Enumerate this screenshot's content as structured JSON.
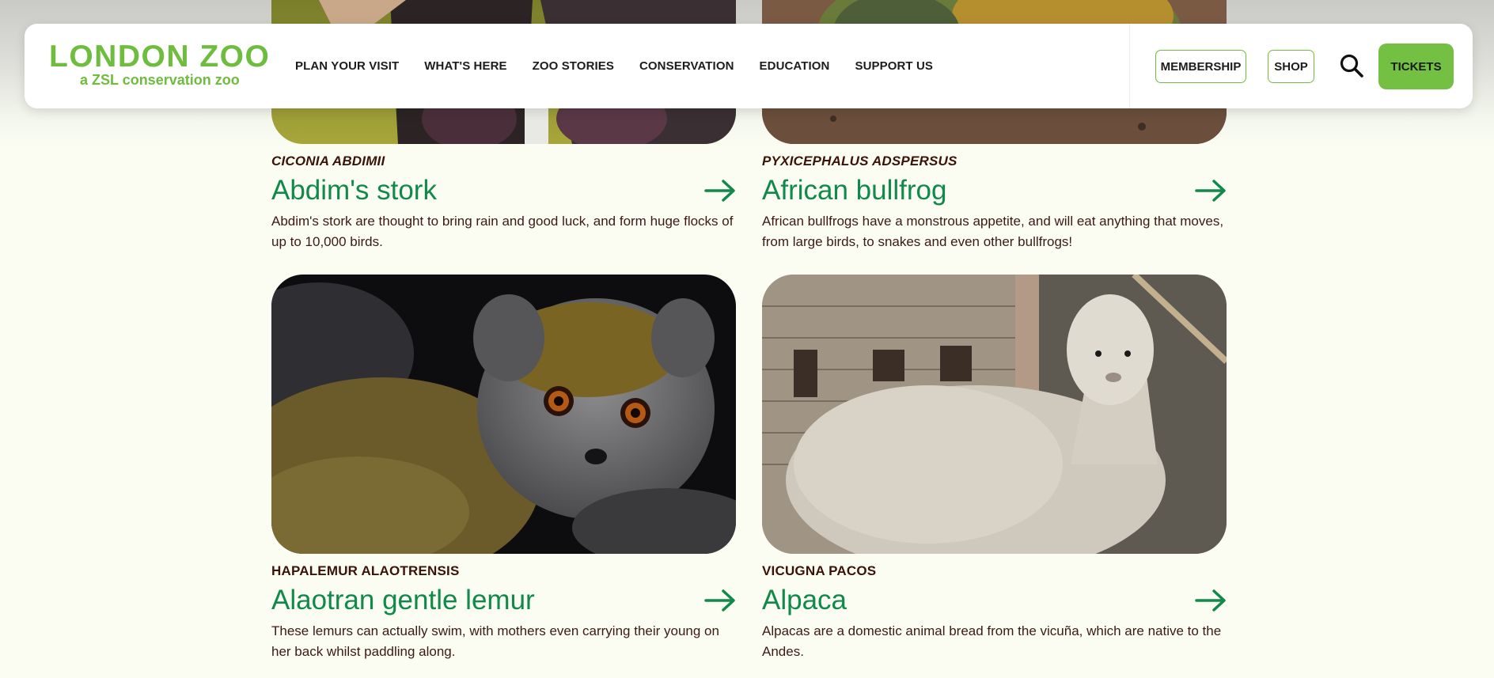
{
  "brand": {
    "logo_main": "LONDON ZOO",
    "logo_sub": "a ZSL conservation zoo",
    "accent": "#6fbd3f",
    "title_green": "#10894a",
    "background": "#fbfdf3"
  },
  "nav": {
    "items": [
      {
        "label": "PLAN YOUR VISIT"
      },
      {
        "label": "WHAT'S HERE"
      },
      {
        "label": "ZOO STORIES"
      },
      {
        "label": "CONSERVATION"
      },
      {
        "label": "EDUCATION"
      },
      {
        "label": "SUPPORT US"
      }
    ],
    "membership_label": "MEMBERSHIP",
    "shop_label": "SHOP",
    "search_icon": "search-icon",
    "tickets_label": "TICKETS"
  },
  "animals": [
    {
      "scientific_name": "CICONIA ABDIMII",
      "name": "Abdim's stork",
      "description": "Abdim's stork are thought to bring rain and good luck, and form huge flocks of up to 10,000 birds."
    },
    {
      "scientific_name": "PYXICEPHALUS ADSPERSUS",
      "name": "African bullfrog",
      "description": "African bullfrogs have a monstrous appetite, and will eat anything that moves, from large birds, to snakes and even other bullfrogs!"
    },
    {
      "scientific_name": "HAPALEMUR ALAOTRENSIS",
      "name": "Alaotran gentle lemur",
      "description": "These lemurs can actually swim, with mothers even carrying their young on her back whilst paddling along."
    },
    {
      "scientific_name": "VICUGNA PACOS",
      "name": "Alpaca",
      "description": "Alpacas are a domestic animal bread from the vicuña, which are native to the Andes."
    }
  ]
}
